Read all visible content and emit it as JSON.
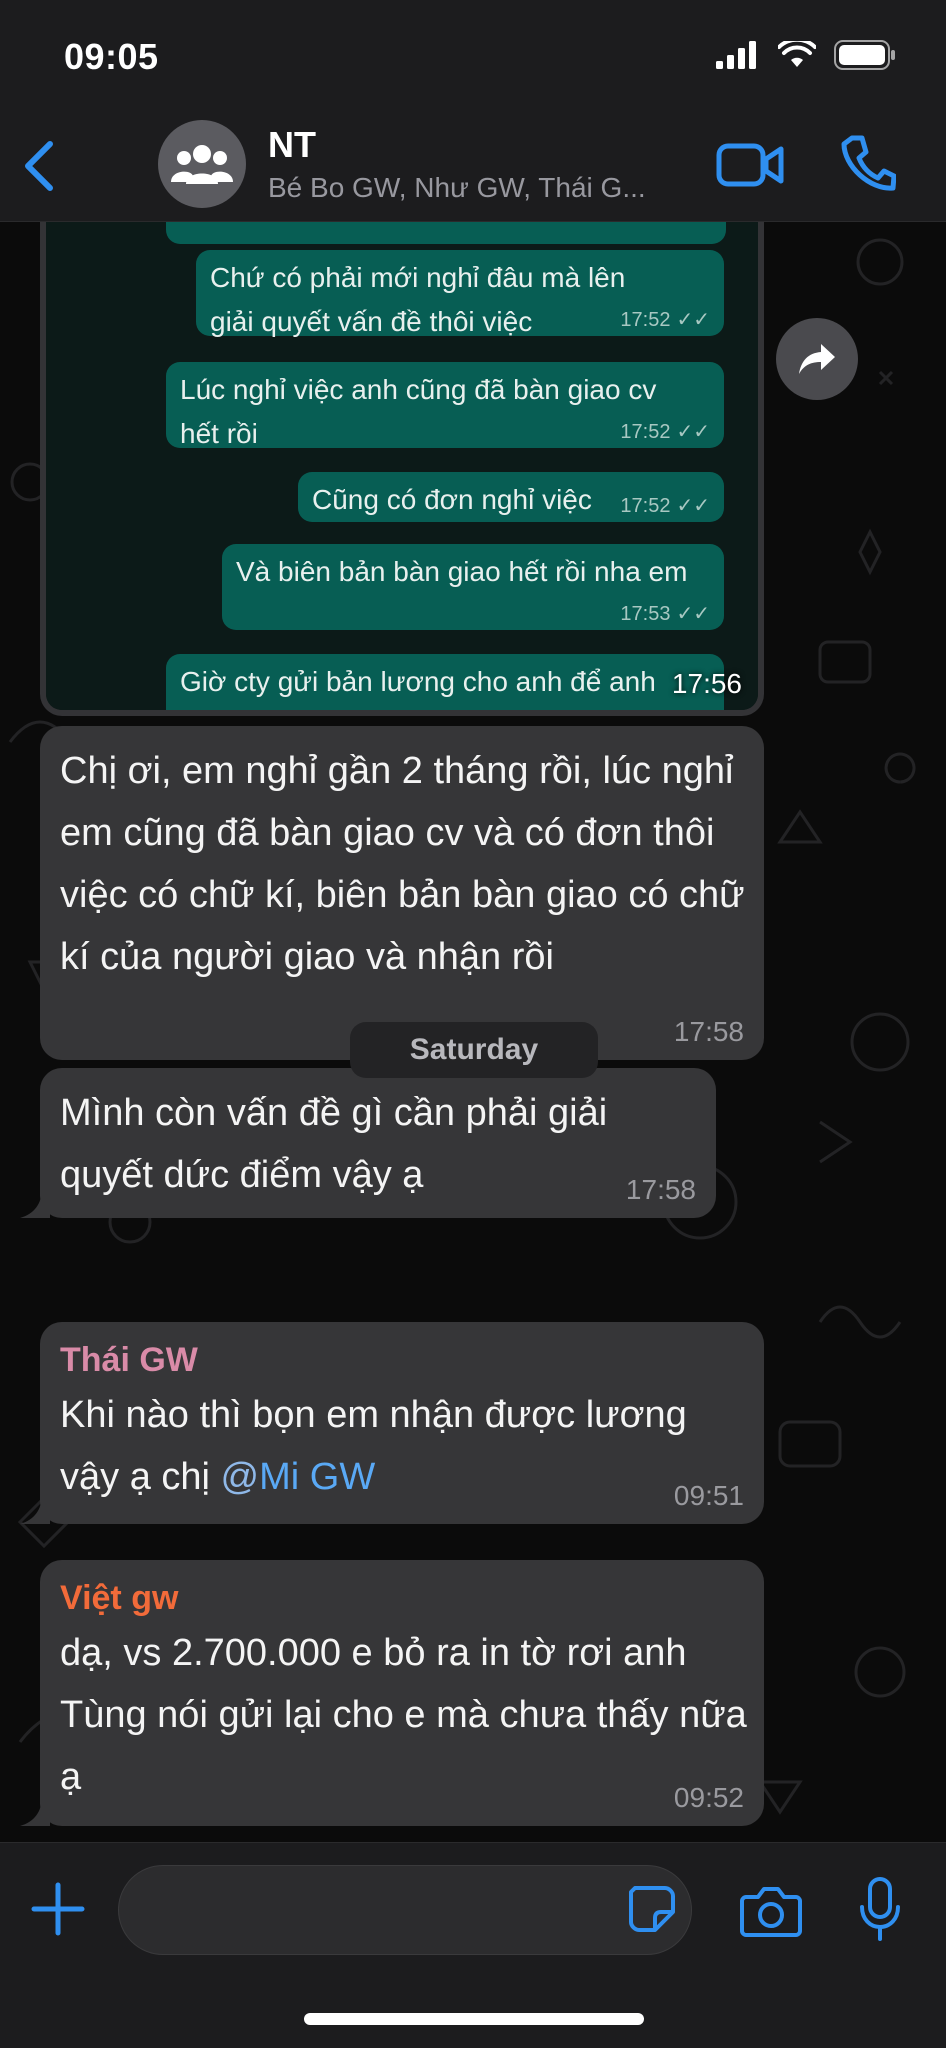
{
  "status_bar": {
    "time": "09:05"
  },
  "header": {
    "title": "NT",
    "subtitle": "Bé Bo GW, Như GW, Thái G..."
  },
  "image_message": {
    "time": "17:56",
    "inner_messages": [
      {
        "text": "Chứ có phải mới nghỉ đâu mà lên giải quyết vấn đề thôi việc",
        "time": "17:52"
      },
      {
        "text": "Lúc nghỉ việc anh cũng đã bàn giao cv hết rồi",
        "time": "17:52"
      },
      {
        "text": "Cũng có đơn nghỉ việc",
        "time": "17:52"
      },
      {
        "text": "Và biên bản bàn giao hết rồi nha em",
        "time": "17:53"
      },
      {
        "text": "Giờ cty gửi bản lương cho anh để anh",
        "time": ""
      }
    ]
  },
  "messages": [
    {
      "text": "Chị ơi, em nghỉ gần 2 tháng rồi, lúc nghỉ em cũng đã bàn giao cv và có đơn thôi việc có chữ kí, biên bản bàn giao có chữ kí của người giao và nhận rồi",
      "time": "17:58"
    },
    {
      "text": "Mình còn vấn đề gì cần phải giải quyết dức điểm vậy ạ",
      "time": "17:58"
    }
  ],
  "day_separator": "Saturday",
  "group_messages": [
    {
      "sender": "Thái GW",
      "sender_color": "#d98ba8",
      "text": "Khi nào thì bọn em nhận được lương vậy ạ chị ",
      "mention_at": "@",
      "mention": "Mi GW",
      "time": "09:51"
    },
    {
      "sender": "Việt gw",
      "sender_color": "#f26b3a",
      "text": "dạ, vs 2.700.000 e bỏ ra in tờ rơi anh Tùng nói gửi lại cho e mà chưa thấy nữa ạ",
      "time": "09:52"
    }
  ],
  "colors": {
    "accent": "#2f8ff0",
    "outgoing": "#075e54",
    "incoming": "#363638"
  }
}
